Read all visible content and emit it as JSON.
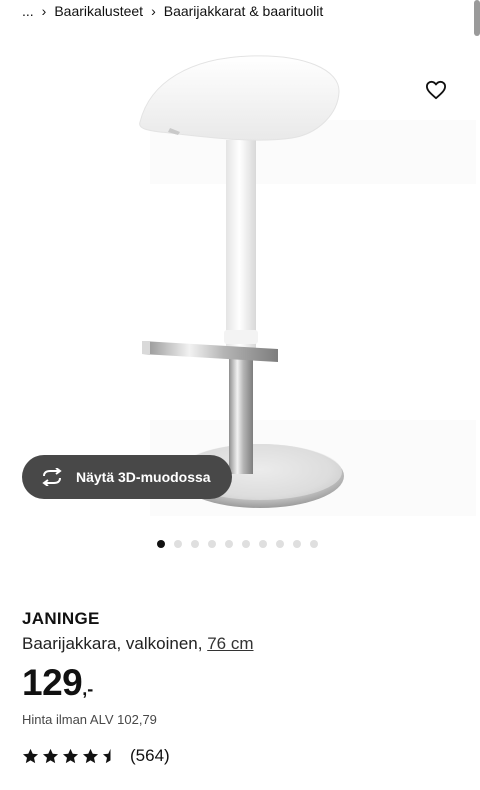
{
  "breadcrumb": {
    "ellipsis": "...",
    "items": [
      "Baarikalusteet",
      "Baarijakkarat & baarituolit"
    ]
  },
  "actions": {
    "view_3d_label": "Näytä 3D-muodossa",
    "favourite_icon": "heart-outline-icon",
    "view_3d_icon": "rotate-arrows-icon"
  },
  "gallery": {
    "image_count": 10,
    "active_index": 0
  },
  "product": {
    "name": "JANINGE",
    "description": "Baarijakkara, valkoinen,",
    "size": "76 cm",
    "price_integer": "129",
    "price_suffix": ",-",
    "price_ex_vat": "Hinta ilman ALV 102,79",
    "rating": 4.5,
    "rating_max": 5,
    "review_count": "(564)"
  },
  "colors": {
    "button_bg": "#484848",
    "text": "#111111",
    "dot_inactive": "#dfdfdf"
  }
}
